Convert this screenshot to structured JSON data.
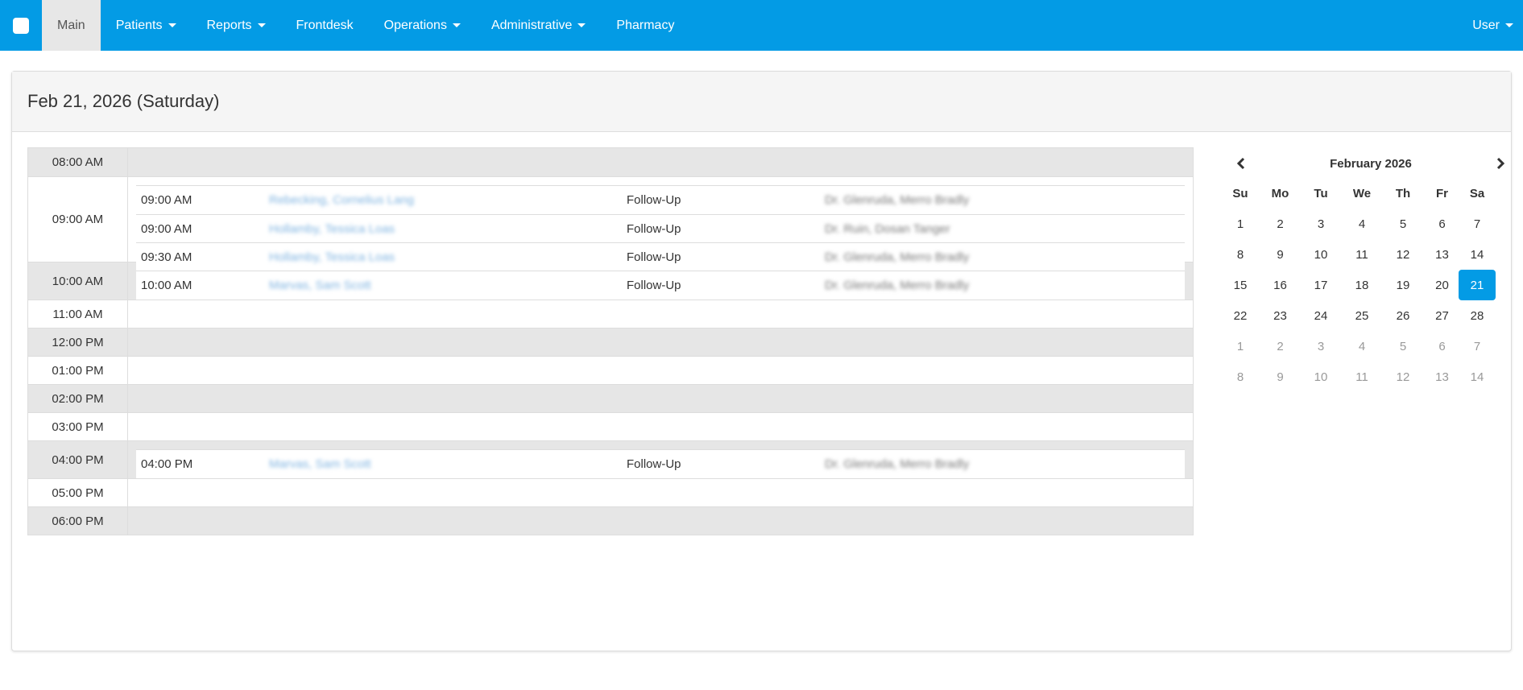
{
  "navbar": {
    "items": [
      {
        "label": "Main",
        "active": true,
        "dropdown": false
      },
      {
        "label": "Patients",
        "active": false,
        "dropdown": true
      },
      {
        "label": "Reports",
        "active": false,
        "dropdown": true
      },
      {
        "label": "Frontdesk",
        "active": false,
        "dropdown": false
      },
      {
        "label": "Operations",
        "active": false,
        "dropdown": true
      },
      {
        "label": "Administrative",
        "active": false,
        "dropdown": true
      },
      {
        "label": "Pharmacy",
        "active": false,
        "dropdown": false
      }
    ],
    "user_label": "User",
    "accent_color": "#039be5"
  },
  "page": {
    "title": "Feb 21, 2026 (Saturday)"
  },
  "schedule": {
    "hours": [
      {
        "label": "08:00 AM",
        "appointments": []
      },
      {
        "label": "09:00 AM",
        "appointments": [
          {
            "time": "09:00 AM",
            "patient": "Rebecking, Cornelius Lang",
            "type": "Follow-Up",
            "provider": "Dr. Glenruda, Merro Bradly"
          },
          {
            "time": "09:00 AM",
            "patient": "Hollamby, Tessica Loas",
            "type": "Follow-Up",
            "provider": "Dr. Ruin, Dosan Tanger"
          },
          {
            "time": "09:30 AM",
            "patient": "Hollamby, Tessica Loas",
            "type": "Follow-Up",
            "provider": "Dr. Glenruda, Merro Bradly"
          }
        ]
      },
      {
        "label": "10:00 AM",
        "appointments": [
          {
            "time": "10:00 AM",
            "patient": "Marvas, Sam Scott",
            "type": "Follow-Up",
            "provider": "Dr. Glenruda, Merro Bradly"
          }
        ]
      },
      {
        "label": "11:00 AM",
        "appointments": []
      },
      {
        "label": "12:00 PM",
        "appointments": []
      },
      {
        "label": "01:00 PM",
        "appointments": []
      },
      {
        "label": "02:00 PM",
        "appointments": []
      },
      {
        "label": "03:00 PM",
        "appointments": []
      },
      {
        "label": "04:00 PM",
        "appointments": [
          {
            "time": "04:00 PM",
            "patient": "Marvas, Sam Scott",
            "type": "Follow-Up",
            "provider": "Dr. Glenruda, Merro Bradly"
          }
        ]
      },
      {
        "label": "05:00 PM",
        "appointments": []
      },
      {
        "label": "06:00 PM",
        "appointments": []
      }
    ]
  },
  "calendar": {
    "title": "February 2026",
    "prev_icon": "chevron-left-icon",
    "next_icon": "chevron-right-icon",
    "weekdays": [
      "Su",
      "Mo",
      "Tu",
      "We",
      "Th",
      "Fr",
      "Sa"
    ],
    "weeks": [
      [
        "1",
        "2",
        "3",
        "4",
        "5",
        "6",
        "7"
      ],
      [
        "8",
        "9",
        "10",
        "11",
        "12",
        "13",
        "14"
      ],
      [
        "15",
        "16",
        "17",
        "18",
        "19",
        "20",
        "21"
      ],
      [
        "22",
        "23",
        "24",
        "25",
        "26",
        "27",
        "28"
      ],
      [
        "1",
        "2",
        "3",
        "4",
        "5",
        "6",
        "7"
      ],
      [
        "8",
        "9",
        "10",
        "11",
        "12",
        "13",
        "14"
      ]
    ],
    "selected_day": "21",
    "muted_weeks": [
      4,
      5
    ]
  }
}
